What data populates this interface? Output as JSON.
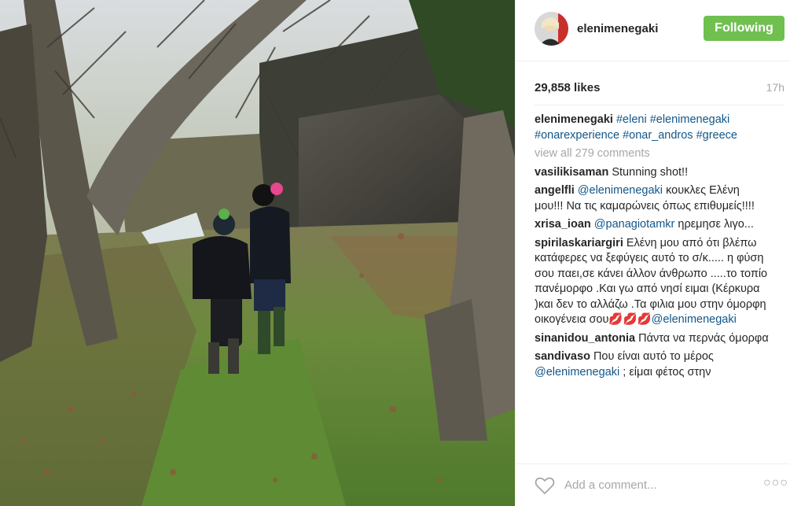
{
  "post": {
    "username": "elenimenegaki",
    "follow_label": "Following",
    "likes": "29,858 likes",
    "time": "17h",
    "view_all": "view all 279 comments",
    "add_comment_placeholder": "Add a comment...",
    "more_label": "○○○"
  },
  "colors": {
    "follow_button": "#70c050",
    "link": "#125688",
    "muted": "#a5a7aa"
  },
  "caption": {
    "author": "elenimenegaki",
    "hashtags": [
      "#eleni",
      "#elenimenegaki",
      "#onarexperience",
      "#onar_andros",
      "#greece"
    ]
  },
  "comments": [
    {
      "author": "vasilikisaman",
      "text": "Stunning shot!!"
    },
    {
      "author": "angelfli",
      "mention": "@elenimenegaki",
      "text": "κουκλες Ελένη μου!!! Να τις καμαρώνεις όπως επιθυμείς!!!!"
    },
    {
      "author": "xrisa_ioan",
      "mention": "@panagiotamkr",
      "text": "ηρεμησε λιγο..."
    },
    {
      "author": "spirilaskariargiri",
      "text": "Ελένη μου από ότι βλέπω κατάφερες να ξεφύγεις αυτό το σ/κ..... η φύση σου παει,σε κάνει άλλον άνθρωπο .....το τοπίο πανέμορφο .Και γω από νησί ειμαι (Κέρκυρα )και δεν το αλλάζω .Τα φιλια μου στην όμορφη οικογένεια σου💋💋💋",
      "mention_end": "@elenimenegaki"
    },
    {
      "author": "sinanidou_antonia",
      "text": "Πάντα να περνάς όμορφα"
    },
    {
      "author": "sandivaso",
      "text": "Που είναι αυτό το μέρος",
      "mention_line": "@elenimenegaki",
      "text_after": "; είμαι φέτος στην"
    }
  ]
}
